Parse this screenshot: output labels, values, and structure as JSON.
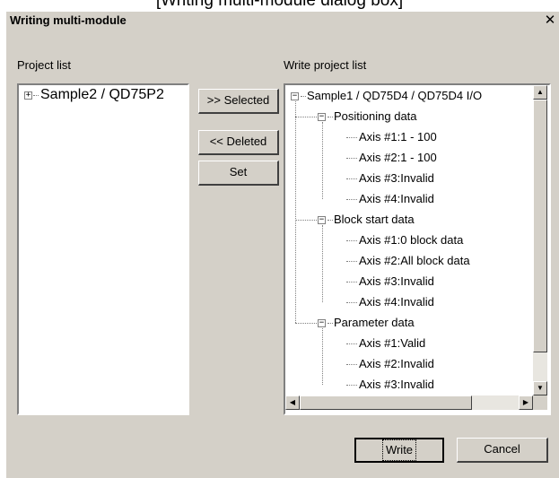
{
  "caption": "[Writing multi-module dialog box]",
  "window": {
    "title": "Writing multi-module",
    "close_glyph": "✕"
  },
  "labels": {
    "project_list": "Project list",
    "write_project_list": "Write project list"
  },
  "project_list": {
    "items": [
      {
        "label": "Sample2 / QD75P2",
        "expander": "+"
      }
    ]
  },
  "buttons": {
    "selected": ">> Selected",
    "deleted": "<< Deleted",
    "set": "Set",
    "write": "Write",
    "cancel": "Cancel"
  },
  "write_tree": {
    "root": {
      "label": "Sample1 / QD75D4 / QD75D4 I/O",
      "expander": "−"
    },
    "groups": [
      {
        "label": "Positioning data",
        "expander": "−",
        "children": [
          "Axis #1:1 - 100",
          "Axis #2:1 - 100",
          "Axis #3:Invalid",
          "Axis #4:Invalid"
        ]
      },
      {
        "label": "Block start data",
        "expander": "−",
        "children": [
          "Axis #1:0 block data",
          "Axis #2:All block data",
          "Axis #3:Invalid",
          "Axis #4:Invalid"
        ]
      },
      {
        "label": "Parameter data",
        "expander": "−",
        "children": [
          "Axis #1:Valid",
          "Axis #2:Invalid",
          "Axis #3:Invalid"
        ]
      }
    ]
  },
  "scroll_glyphs": {
    "up": "▲",
    "down": "▼",
    "left": "◀",
    "right": "▶"
  }
}
